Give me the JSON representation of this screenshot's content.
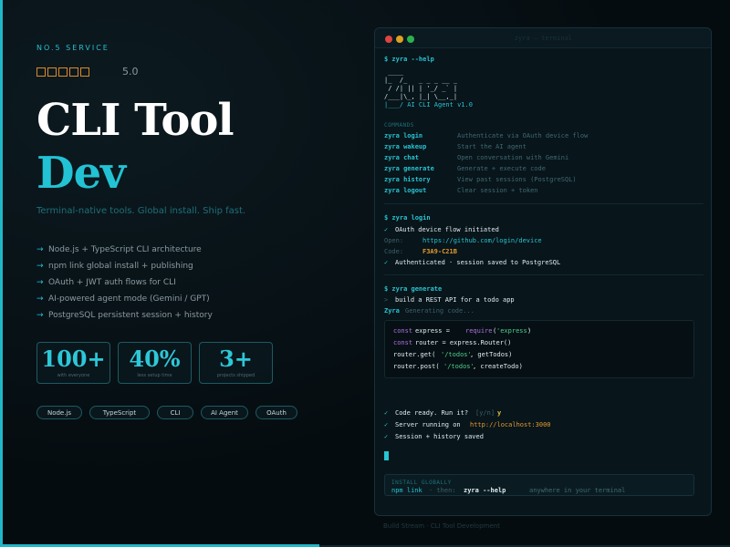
{
  "left": {
    "eyebrow": "NO.5 SERVICE",
    "rating": "5.0",
    "title_line1": "CLI Tool",
    "title_line2": "Dev",
    "tagline": "Terminal-native tools. Global install. Ship fast.",
    "features": [
      "Node.js + TypeScript CLI architecture",
      "npm link global install + publishing",
      "OAuth + JWT auth flows for CLI",
      "AI-powered agent mode (Gemini / GPT)",
      "PostgreSQL persistent session + history"
    ],
    "stats": [
      {
        "value": "100+",
        "label": "with everyone"
      },
      {
        "value": "40%",
        "label": "less setup time"
      },
      {
        "value": "3+",
        "label": "projects shipped"
      }
    ],
    "chips": [
      "Node.js",
      "TypeScript",
      "CLI",
      "AI Agent",
      "OAuth"
    ]
  },
  "terminal": {
    "title": "zyra — terminal",
    "help_cmd": "$ zyra --help",
    "ascii": [
      " ____",
      "|_  /_   _ _ _ __ _",
      " / /| || | '_/ _` |",
      "/___|\\_, |_| \\__,_|",
      "|___/ AI CLI Agent v1.0"
    ],
    "commands_label": "COMMANDS",
    "commands": [
      {
        "key": "zyra login",
        "desc": "Authenticate via OAuth device flow"
      },
      {
        "key": "zyra wakeup",
        "desc": "Start the AI agent"
      },
      {
        "key": "zyra chat",
        "desc": "Open conversation with Gemini"
      },
      {
        "key": "zyra generate",
        "desc": "Generate + execute code"
      },
      {
        "key": "zyra history",
        "desc": "View past sessions (PostgreSQL)"
      },
      {
        "key": "zyra logout",
        "desc": "Clear session + token"
      }
    ],
    "login_cmd": "$ zyra login",
    "login_flow": "OAuth device flow initiated",
    "open_label": "Open:",
    "open_url": "https://github.com/login/device",
    "code_label": "Code:",
    "code_value": "F3A9-C21B",
    "auth_ok": "Authenticated · session saved to PostgreSQL",
    "generate_cmd": "$ zyra generate",
    "prompt_arrow": ">",
    "prompt_text": "build a REST API for a todo app",
    "agent_name": "Zyra",
    "agent_status": "Generating code...",
    "code": {
      "l1_kw": "const",
      "l1_name": "express =",
      "l1_fn": "require",
      "l1_paren_open": "(",
      "l1_str": "'express'",
      "l1_paren_close": ")",
      "l2_kw": "const",
      "l2_rest": "router = express.Router()",
      "l3_a": "router.get(",
      "l3_str": "'/todos'",
      "l3_b": ", getTodos)",
      "l4_a": "router.post(",
      "l4_str": "'/todos'",
      "l4_b": ", createTodo)"
    },
    "ready_text": "Code ready. Run it?",
    "ready_hint": "[y/n]",
    "ready_answer": "y",
    "server_text": "Server running on",
    "server_url": "http://localhost:3000",
    "session_text": "Session + history saved",
    "install_label": "INSTALL GLOBALLY",
    "install_cmd": "npm link",
    "install_then": "· then:",
    "install_run": "zyra --help",
    "install_tail": "anywhere in your terminal"
  },
  "footer": "Build Stream · CLI Tool Development",
  "check_glyph": "✓",
  "colors": {
    "accent": "#22c2d4",
    "star": "#d98a2b",
    "background": "#050c10"
  }
}
